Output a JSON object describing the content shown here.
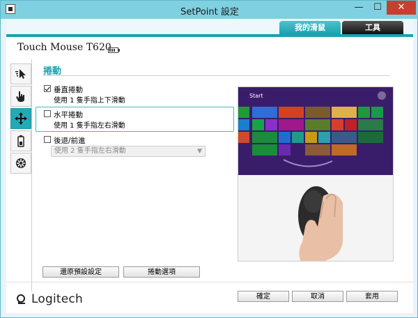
{
  "window": {
    "title": "SetPoint 設定",
    "min_glyph": "—",
    "max_glyph": "☐",
    "close_glyph": "✕"
  },
  "tabs": [
    {
      "label": "我的滑鼠",
      "active": true
    },
    {
      "label": "工具",
      "active": false
    }
  ],
  "device": {
    "name": "Touch Mouse T620",
    "battery_icon": "battery-icon"
  },
  "sidebar": {
    "items": [
      {
        "name": "pointer",
        "icon": "pointer-icon"
      },
      {
        "name": "gesture",
        "icon": "hand-icon"
      },
      {
        "name": "scroll",
        "icon": "move-arrows-icon",
        "active": true
      },
      {
        "name": "battery",
        "icon": "battery-icon"
      },
      {
        "name": "settings",
        "icon": "gear-icon"
      }
    ]
  },
  "section": {
    "title": "捲動"
  },
  "options": [
    {
      "label": "垂直捲動",
      "desc": "使用 1 隻手指上下滑動",
      "checked": true
    },
    {
      "label": "水平捲動",
      "desc": "使用 1 隻手指左右滑動",
      "checked": false
    },
    {
      "label": "後退/前進",
      "desc": "",
      "checked": false
    }
  ],
  "back_forward_select": {
    "value": "使用 2 隻手指左右滑動"
  },
  "preview": {
    "start_label": "Start"
  },
  "buttons": {
    "restore": "還原預設設定",
    "scroll_options": "捲動選項",
    "ok": "確定",
    "cancel": "取消",
    "apply": "套用"
  },
  "brand": {
    "name": "Logitech"
  },
  "colors": {
    "accent": "#18a3ae",
    "titlebar": "#7fd0e0",
    "close": "#c7402f"
  }
}
